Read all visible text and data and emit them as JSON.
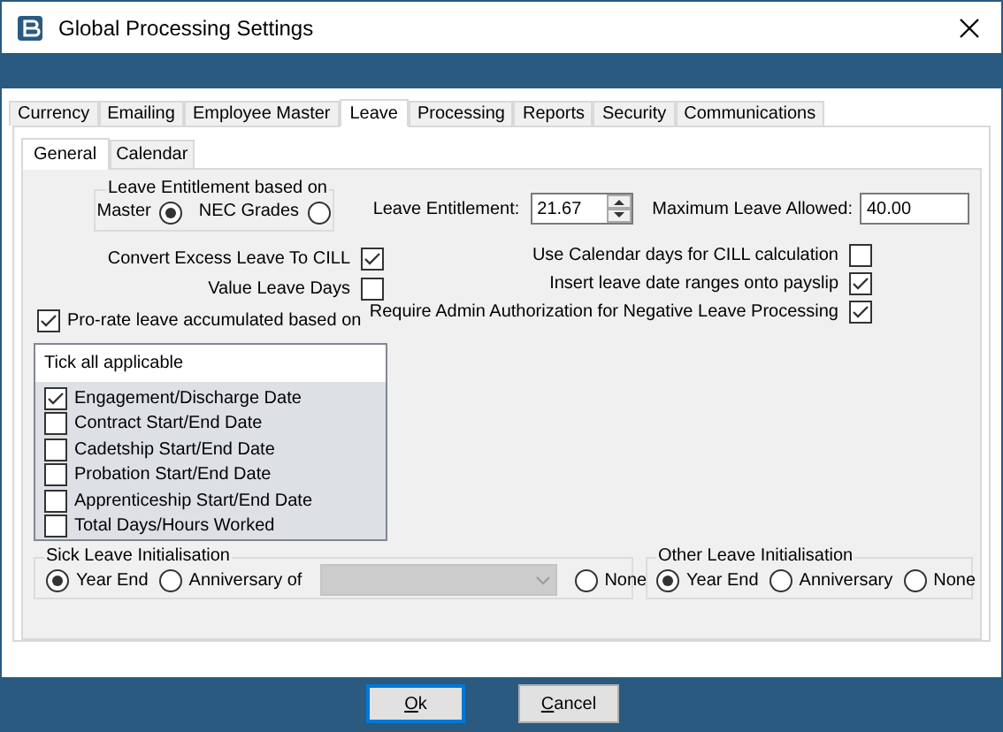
{
  "window": {
    "title": "Global Processing Settings"
  },
  "tabs": [
    {
      "label": "Currency",
      "selected": false
    },
    {
      "label": "Emailing",
      "selected": false
    },
    {
      "label": "Employee Master",
      "selected": false
    },
    {
      "label": "Leave",
      "selected": true
    },
    {
      "label": "Processing",
      "selected": false
    },
    {
      "label": "Reports",
      "selected": false
    },
    {
      "label": "Security",
      "selected": false
    },
    {
      "label": "Communications",
      "selected": false
    }
  ],
  "subtabs": [
    {
      "label": "General",
      "selected": true
    },
    {
      "label": "Calendar",
      "selected": false
    }
  ],
  "entitlement_basis": {
    "legend": "Leave Entitlement based on",
    "options": [
      {
        "label": "Master",
        "selected": true
      },
      {
        "label": "NEC Grades",
        "selected": false
      }
    ]
  },
  "leave_entitlement": {
    "label": "Leave Entitlement:",
    "value": "21.67"
  },
  "maximum_leave": {
    "label": "Maximum Leave Allowed:",
    "value": "40.00"
  },
  "left_options": [
    {
      "label": "Convert Excess Leave To CILL",
      "checked": true
    },
    {
      "label": "Value Leave Days",
      "checked": false
    }
  ],
  "right_options": [
    {
      "label": "Use Calendar days for CILL calculation",
      "checked": false
    },
    {
      "label": "Insert leave date ranges onto payslip",
      "checked": true
    },
    {
      "label": "Require Admin Authorization for Negative Leave Processing",
      "checked": true
    }
  ],
  "prorate": {
    "label": "Pro-rate leave accumulated based on",
    "checked": true
  },
  "applicable_list": {
    "header": "Tick all applicable",
    "items": [
      {
        "label": "Engagement/Discharge Date",
        "checked": true
      },
      {
        "label": "Contract Start/End Date",
        "checked": false
      },
      {
        "label": "Cadetship Start/End Date",
        "checked": false
      },
      {
        "label": "Probation Start/End Date",
        "checked": false
      },
      {
        "label": "Apprenticeship Start/End Date",
        "checked": false
      },
      {
        "label": "Total Days/Hours Worked",
        "checked": false
      }
    ]
  },
  "sick_leave": {
    "legend": "Sick Leave Initialisation",
    "options": [
      {
        "label": "Year End",
        "selected": true,
        "kind": "radio"
      },
      {
        "label": "Anniversary of",
        "selected": false,
        "kind": "radio-dropdown"
      },
      {
        "label": "None",
        "selected": false,
        "kind": "radio"
      }
    ]
  },
  "other_leave": {
    "legend": "Other Leave Initialisation",
    "options": [
      {
        "label": "Year End",
        "selected": true
      },
      {
        "label": "Anniversary",
        "selected": false
      },
      {
        "label": "None",
        "selected": false
      }
    ]
  },
  "buttons": [
    {
      "label": "Ok",
      "default": true
    },
    {
      "label": "Cancel",
      "default": false
    }
  ]
}
